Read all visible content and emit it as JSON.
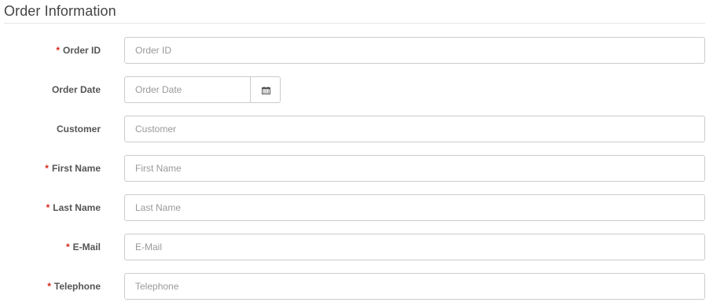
{
  "section": {
    "title": "Order Information"
  },
  "fields": {
    "order_id": {
      "label": "Order ID",
      "required": "*",
      "placeholder": "Order ID",
      "value": ""
    },
    "order_date": {
      "label": "Order Date",
      "placeholder": "Order Date",
      "value": ""
    },
    "customer": {
      "label": "Customer",
      "placeholder": "Customer",
      "value": ""
    },
    "first_name": {
      "label": "First Name",
      "required": "*",
      "placeholder": "First Name",
      "value": ""
    },
    "last_name": {
      "label": "Last Name",
      "required": "*",
      "placeholder": "Last Name",
      "value": ""
    },
    "email": {
      "label": "E-Mail",
      "required": "*",
      "placeholder": "E-Mail",
      "value": ""
    },
    "telephone": {
      "label": "Telephone",
      "required": "*",
      "placeholder": "Telephone",
      "value": ""
    }
  },
  "icons": {
    "date_picker": "calendar-icon"
  },
  "colors": {
    "required_marker": "#d9261c",
    "input_border": "#cccccc",
    "label_text": "#555555",
    "placeholder_text": "#999999"
  }
}
